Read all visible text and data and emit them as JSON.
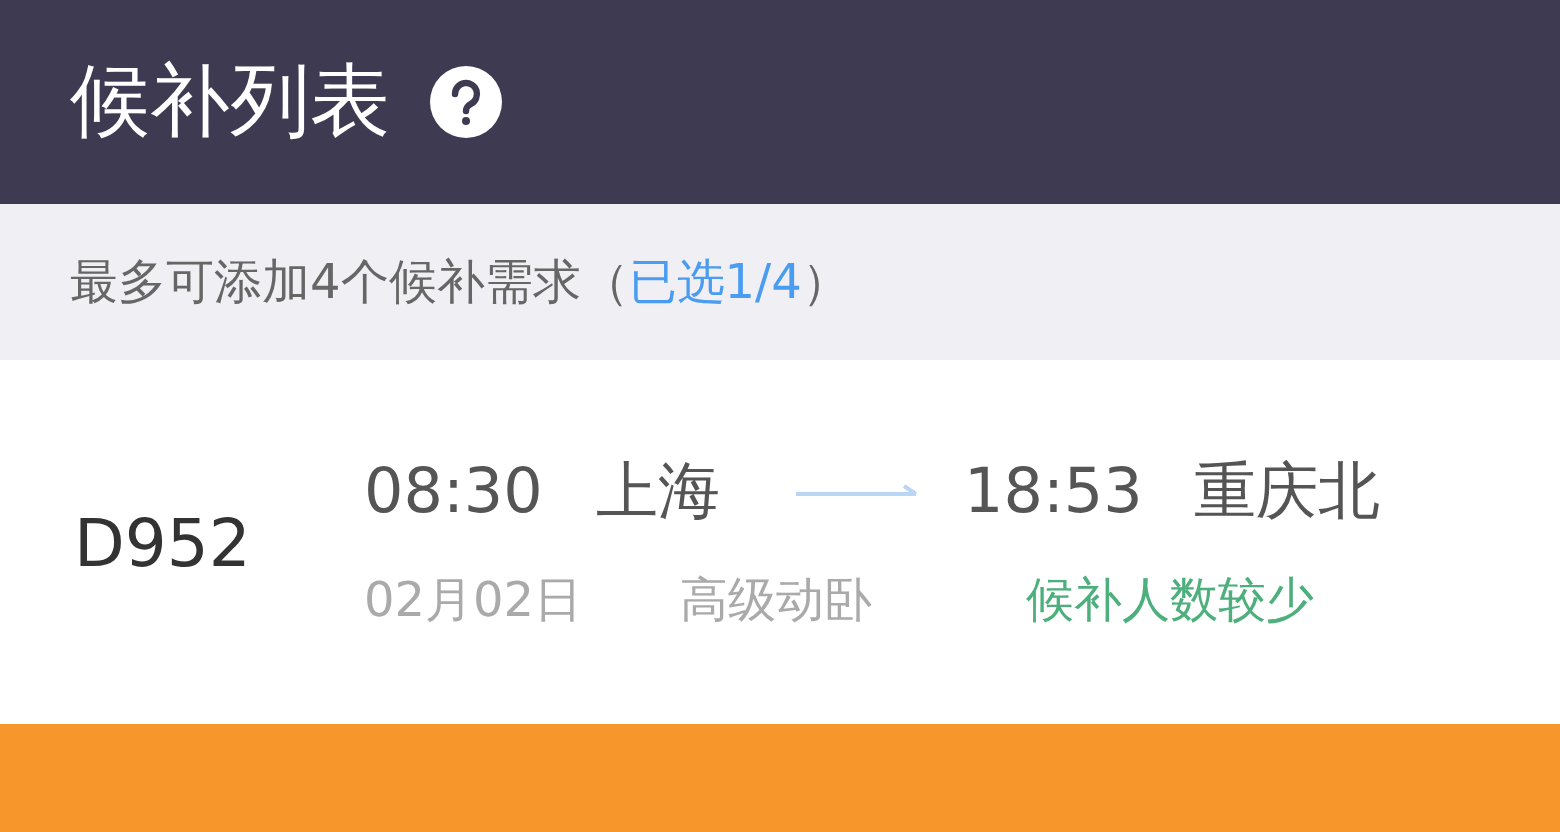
{
  "header": {
    "title": "候补列表"
  },
  "notice": {
    "text": "最多可添加4个候补需求（",
    "highlight": "已选1/4",
    "close": "）"
  },
  "trains": [
    {
      "number": "D952",
      "depart_time": "08:30",
      "depart_station": "上海",
      "arrive_time": "18:53",
      "arrive_station": "重庆北",
      "date": "02月02日",
      "seat": "高级动卧",
      "status": "候补人数较少",
      "color": "#4caf7c"
    }
  ]
}
